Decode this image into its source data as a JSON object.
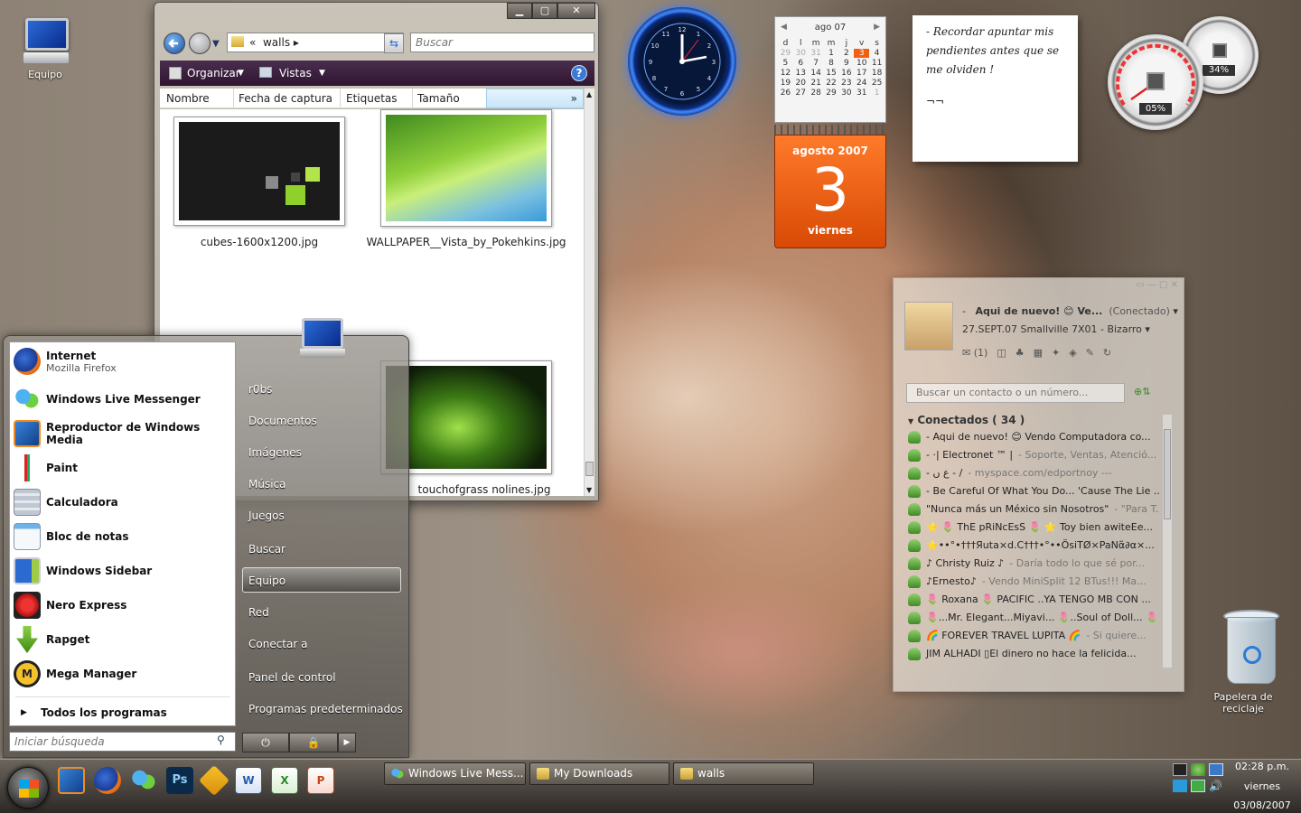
{
  "desktop": {
    "icons": [
      {
        "label": "Equipo"
      },
      {
        "label": "Papelera de reciclaje"
      }
    ]
  },
  "explorer": {
    "address": [
      "«",
      "walls"
    ],
    "search_placeholder": "Buscar",
    "toolbar": {
      "organize": "Organizar",
      "views": "Vistas"
    },
    "columns": [
      "Nombre",
      "Fecha de captura",
      "Etiquetas",
      "Tamaño"
    ],
    "files": [
      {
        "name": "cubes-1600x1200.jpg"
      },
      {
        "name": "WALLPAPER__Vista_by_Pokehkins.jpg"
      },
      {
        "name": "touchofgrass nolines.jpg"
      }
    ]
  },
  "calendar": {
    "month_header": "ago 07",
    "weekdays": [
      "d",
      "l",
      "m",
      "m",
      "j",
      "v",
      "s"
    ],
    "days": [
      "29",
      "30",
      "31",
      "1",
      "2",
      "3",
      "4",
      "5",
      "6",
      "7",
      "8",
      "9",
      "10",
      "11",
      "12",
      "13",
      "14",
      "15",
      "16",
      "17",
      "18",
      "19",
      "20",
      "21",
      "22",
      "23",
      "24",
      "25",
      "26",
      "27",
      "28",
      "29",
      "30",
      "31",
      "1"
    ],
    "month_year": "agosto 2007",
    "day_number": "3",
    "weekday": "viernes"
  },
  "note": {
    "lines": [
      "- Recordar apuntar mis",
      "pendientes antes que se",
      "me olviden !",
      "¬¬"
    ]
  },
  "meters": {
    "cpu": "05%",
    "memory": "34%"
  },
  "start_menu": {
    "pinned": [
      {
        "title": "Internet",
        "subtitle": "Mozilla Firefox"
      }
    ],
    "programs": [
      "Windows Live Messenger",
      "Reproductor de Windows Media",
      "Paint",
      "Calculadora",
      "Bloc de notas",
      "Windows Sidebar",
      "Nero Express",
      "Rapget",
      "Mega Manager"
    ],
    "all_programs": "Todos los programas",
    "search_placeholder": "Iniciar búsqueda",
    "right": [
      "r0bs",
      "Documentos",
      "Imágenes",
      "Música",
      "Juegos",
      "Buscar",
      "Equipo",
      "Red",
      "Conectar a",
      "Panel de control",
      "Programas predeterminados"
    ]
  },
  "messenger": {
    "display_name": "Aqui de nuevo! 😊 Ve...",
    "status": "(Conectado)",
    "personal_message": "27.SEPT.07 Smallville 7X01 - Bizarro",
    "mail_count": "(1)",
    "search_placeholder": "Buscar un contacto o un número...",
    "group": "Conectados ( 34 )",
    "contacts": [
      {
        "name": "-   Aqui de nuevo! 😊 Vendo Computadora co...",
        "message": ""
      },
      {
        "name": "- ·| Electronet ™ |",
        "message": "- Soporte, Ventas, Atenció..."
      },
      {
        "name": "- ع   ں   - /",
        "message": "- myspace.com/edportnoy   ---"
      },
      {
        "name": "- Be Careful Of What You Do... 'Cause The Lie ...",
        "message": ""
      },
      {
        "name": "\"Nunca más un México sin Nosotros\"",
        "message": "- \"Para T..."
      },
      {
        "name": "⭐ 🌷 ThE pRiNcEsS 🌷 ⭐ Toy bien awiteEe...",
        "message": ""
      },
      {
        "name": "⭐••°•†††Яuta×d.C†††•°••ÖsiTØ×PaNα̃∂α×...",
        "message": ""
      },
      {
        "name": "♪ Christy Ruiz ♪",
        "message": "- Daría todo lo que sé por..."
      },
      {
        "name": "♪Ernesto♪",
        "message": "- Vendo MiniSplit 12 BTus!!! Ma..."
      },
      {
        "name": "🌷 Roxana 🌷 PACIFIC ..YA TENGO MB CON ...",
        "message": ""
      },
      {
        "name": "🌷...Mr. Elegant...Miyavi... 🌷..Soul of Doll... 🌷",
        "message": ""
      },
      {
        "name": "🌈 FOREVER TRAVEL LUPITA 🌈",
        "message": "- Si quiere..."
      },
      {
        "name": "JIM ALHADI ▯El dinero no hace la felicida...",
        "message": ""
      }
    ]
  },
  "taskbar": {
    "windows": [
      "Windows Live Mess...",
      "My Downloads",
      "walls"
    ],
    "time": "02:28 p.m.",
    "day": "viernes",
    "date": "03/08/2007"
  }
}
